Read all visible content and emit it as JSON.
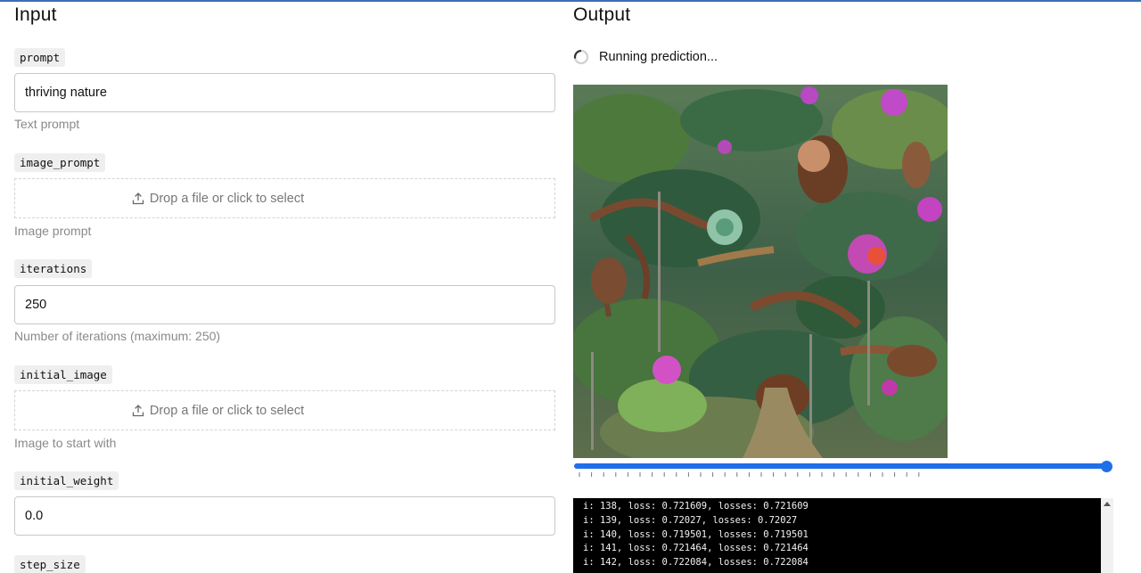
{
  "input": {
    "title": "Input",
    "fields": {
      "prompt": {
        "label": "prompt",
        "value": "thriving nature",
        "help": "Text prompt"
      },
      "image_prompt": {
        "label": "image_prompt",
        "dropzone": "Drop a file or click to select",
        "help": "Image prompt"
      },
      "iterations": {
        "label": "iterations",
        "value": "250",
        "help": "Number of iterations (maximum: 250)"
      },
      "initial_image": {
        "label": "initial_image",
        "dropzone": "Drop a file or click to select",
        "help": "Image to start with"
      },
      "initial_weight": {
        "label": "initial_weight",
        "value": "0.0"
      },
      "step_size": {
        "label": "step_size"
      }
    }
  },
  "output": {
    "title": "Output",
    "status": "Running prediction...",
    "slider": {
      "value_fraction": 1.0,
      "accent": "#1f6fe8"
    },
    "console": {
      "lines": [
        "i: 138, loss: 0.721609, losses: 0.721609",
        "i: 139, loss: 0.72027, losses: 0.72027",
        "i: 140, loss: 0.719501, losses: 0.719501",
        "i: 141, loss: 0.721464, losses: 0.721464",
        "i: 142, loss: 0.722084, losses: 0.722084"
      ]
    }
  },
  "icons": {
    "upload": "upload-icon",
    "spinner": "spinner-icon"
  }
}
